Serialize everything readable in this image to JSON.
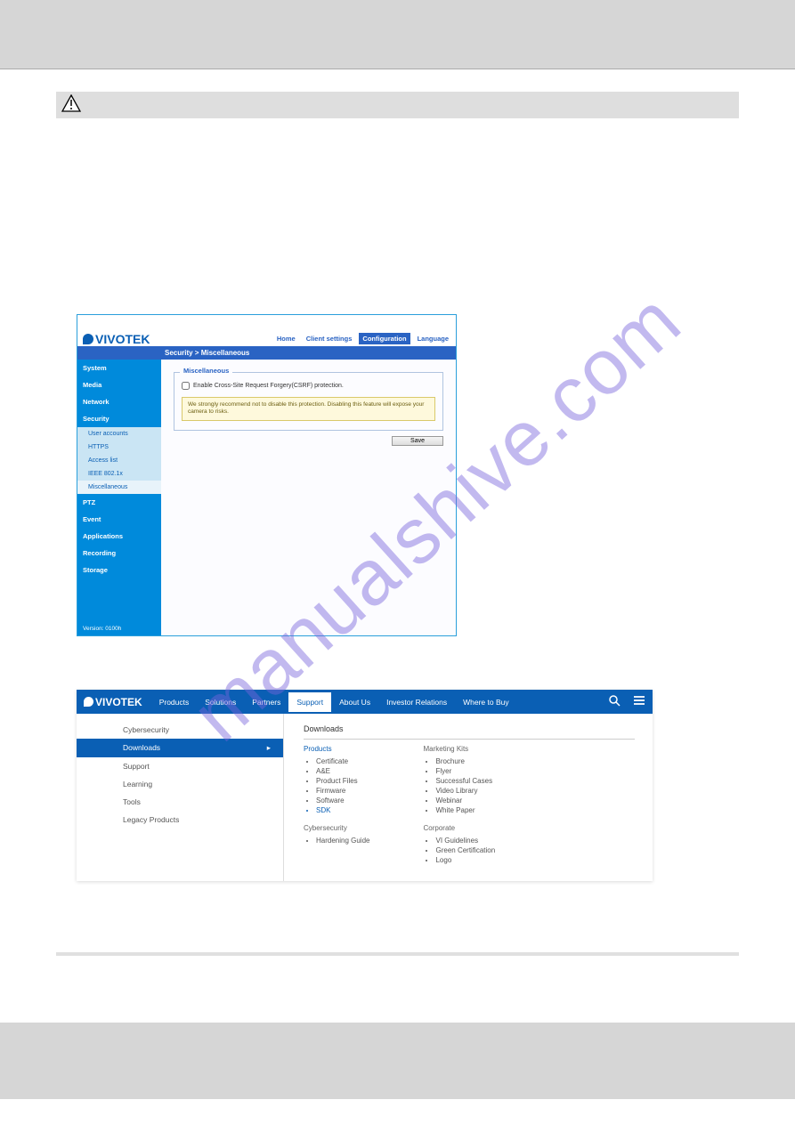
{
  "watermark": "manualshive.com",
  "config_panel": {
    "logo_text": "VIVOTEK",
    "top_tabs": {
      "home": "Home",
      "client": "Client settings",
      "config": "Configuration",
      "lang": "Language"
    },
    "breadcrumb": "Security  >  Miscellaneous",
    "sidebar": {
      "items": {
        "system": "System",
        "media": "Media",
        "network": "Network",
        "security": "Security"
      },
      "sub": {
        "user_accounts": "User accounts",
        "https": "HTTPS",
        "access_list": "Access list",
        "ieee": "IEEE 802.1x",
        "misc": "Miscellaneous"
      },
      "items2": {
        "ptz": "PTZ",
        "event": "Event",
        "apps": "Applications",
        "recording": "Recording",
        "storage": "Storage"
      },
      "version": "Version: 0100h"
    },
    "main": {
      "legend": "Miscellaneous",
      "checkbox_label": "Enable Cross-Site Request Forgery(CSRF) protection.",
      "warning": "We strongly recommend not to disable this protection. Disabling this feature will expose your camera to risks.",
      "save": "Save"
    }
  },
  "site_panel": {
    "logo_text": "VIVOTEK",
    "nav": {
      "products": "Products",
      "solutions": "Solutions",
      "partners": "Partners",
      "support": "Support",
      "about": "About Us",
      "investor": "Investor Relations",
      "where": "Where to Buy"
    },
    "left": {
      "cyber": "Cybersecurity",
      "downloads": "Downloads",
      "support": "Support",
      "learning": "Learning",
      "tools": "Tools",
      "legacy": "Legacy Products"
    },
    "right": {
      "title": "Downloads",
      "col1": {
        "h_products": "Products",
        "li_cert": "Certificate",
        "li_ae": "A&E",
        "li_pf": "Product Files",
        "li_fw": "Firmware",
        "li_sw": "Software",
        "li_sdk": "SDK",
        "h_cyber": "Cybersecurity",
        "li_hg": "Hardening Guide"
      },
      "col2": {
        "h_mk": "Marketing Kits",
        "li_brochure": "Brochure",
        "li_flyer": "Flyer",
        "li_sc": "Successful Cases",
        "li_vl": "Video Library",
        "li_web": "Webinar",
        "li_wp": "White Paper",
        "h_corp": "Corporate",
        "li_vi": "VI Guidelines",
        "li_gc": "Green Certification",
        "li_logo": "Logo"
      }
    }
  }
}
